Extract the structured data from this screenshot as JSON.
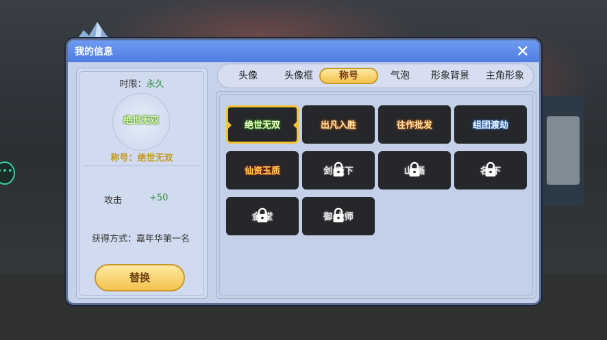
{
  "dialog": {
    "title": "我的信息"
  },
  "info": {
    "duration_label": "时限：",
    "duration_value": "永久",
    "preview_badge_text": "绝世无双",
    "title_label": "称号：绝世无双",
    "attribute": {
      "name": "攻击",
      "value": "+50"
    },
    "obtain": "获得方式：嘉年华第一名",
    "replace_button": "替换"
  },
  "tabs": [
    {
      "label": "头像",
      "active": false
    },
    {
      "label": "头像框",
      "active": false
    },
    {
      "label": "称号",
      "active": true
    },
    {
      "label": "气泡",
      "active": false
    },
    {
      "label": "形象背景",
      "active": false
    },
    {
      "label": "主角形象",
      "active": false
    }
  ],
  "titles": [
    {
      "text": "绝世无双",
      "style": "green",
      "locked": false,
      "selected": true
    },
    {
      "text": "出凡入胜",
      "style": "orange",
      "locked": false,
      "selected": false
    },
    {
      "text": "往作批发",
      "style": "orange",
      "locked": false,
      "selected": false
    },
    {
      "text": "组团渡劫",
      "style": "blue",
      "locked": false,
      "selected": false
    },
    {
      "text": "仙资玉质",
      "style": "fire",
      "locked": false,
      "selected": false
    },
    {
      "text": "剑 天下",
      "style": "gray",
      "locked": true,
      "selected": false
    },
    {
      "text": "山 画",
      "style": "gray",
      "locked": true,
      "selected": false
    },
    {
      "text": "名 下",
      "style": "gray",
      "locked": true,
      "selected": false
    },
    {
      "text": "金 堂",
      "style": "gray",
      "locked": true,
      "selected": false
    },
    {
      "text": "御 大师",
      "style": "gray",
      "locked": true,
      "selected": false
    }
  ],
  "colors": {
    "accent_gold": "#f3c332",
    "title_bar": "#5b89e8",
    "panel": "#c6d2ea",
    "green_value": "#2f8a3a"
  },
  "icons": {
    "close": "close-icon",
    "lock": "lock-icon",
    "chat": "chat-bubble-icon"
  }
}
